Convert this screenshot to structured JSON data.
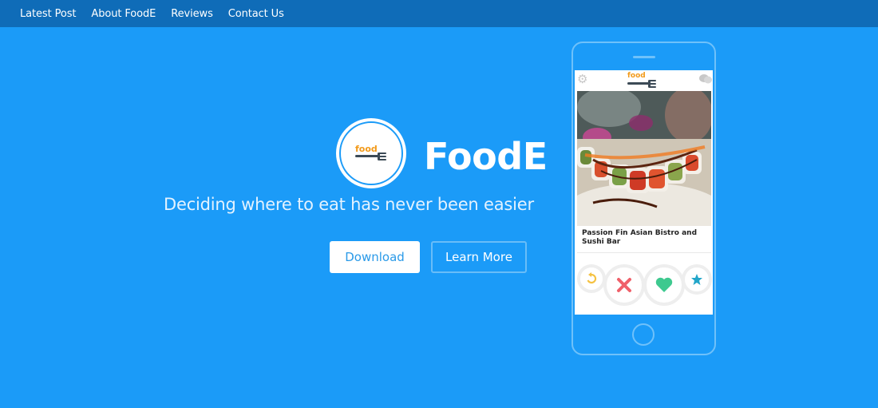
{
  "nav": {
    "items": [
      {
        "label": "Latest Post"
      },
      {
        "label": "About FoodE"
      },
      {
        "label": "Reviews"
      },
      {
        "label": "Contact Us"
      }
    ]
  },
  "hero": {
    "logo_word": "food",
    "brand": "FoodE",
    "tagline": "Deciding where to eat has never been easier",
    "download_label": "Download",
    "learn_more_label": "Learn More"
  },
  "phone": {
    "app_logo_word": "food",
    "card_title": "Passion Fin Asian Bistro and Sushi Bar",
    "controls": [
      {
        "icon": "undo-icon",
        "color": "#f5c242"
      },
      {
        "icon": "close-icon",
        "color": "#f0606a"
      },
      {
        "icon": "heart-icon",
        "color": "#3ec98f"
      },
      {
        "icon": "star-icon",
        "color": "#23a6c9"
      }
    ]
  },
  "colors": {
    "background": "#1b9bf8",
    "nav_bar": "#0f6cb8",
    "logo_orange": "#f29a1a"
  }
}
